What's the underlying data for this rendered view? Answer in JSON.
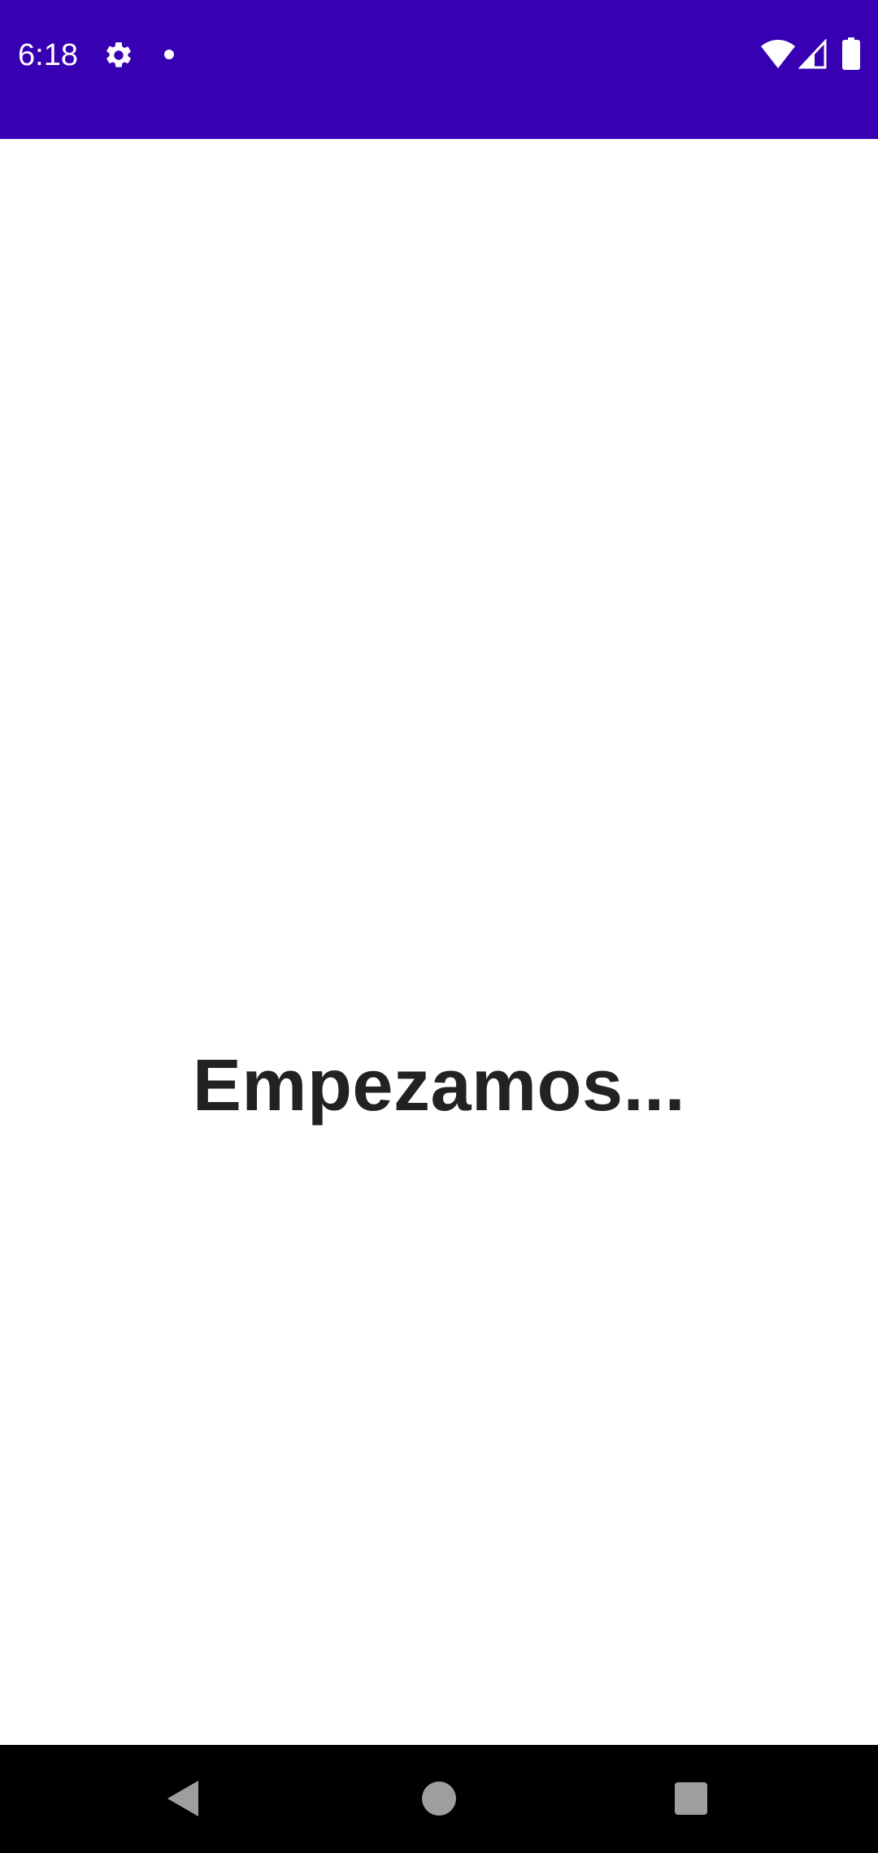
{
  "status_bar": {
    "time": "6:18",
    "background": "#3700b3",
    "icons": [
      "gear-icon",
      "notification-dot-icon",
      "wifi-icon",
      "cell-signal-icon",
      "battery-icon"
    ]
  },
  "main": {
    "headline": "Empezamos..."
  },
  "nav_bar": {
    "buttons": [
      "back",
      "home",
      "recents"
    ],
    "background": "#000000"
  }
}
